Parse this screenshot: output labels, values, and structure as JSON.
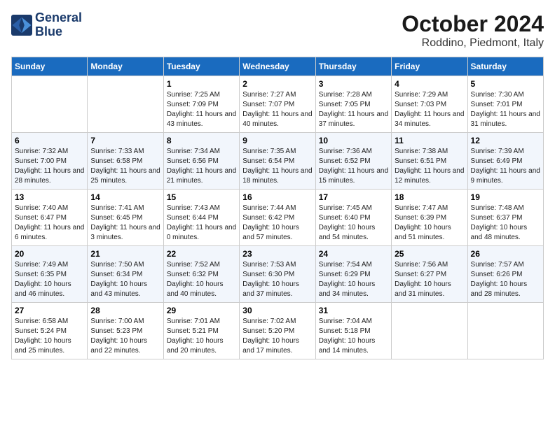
{
  "logo": {
    "line1": "General",
    "line2": "Blue"
  },
  "title": "October 2024",
  "subtitle": "Roddino, Piedmont, Italy",
  "weekdays": [
    "Sunday",
    "Monday",
    "Tuesday",
    "Wednesday",
    "Thursday",
    "Friday",
    "Saturday"
  ],
  "weeks": [
    [
      {
        "day": "",
        "sunrise": "",
        "sunset": "",
        "daylight": ""
      },
      {
        "day": "",
        "sunrise": "",
        "sunset": "",
        "daylight": ""
      },
      {
        "day": "1",
        "sunrise": "Sunrise: 7:25 AM",
        "sunset": "Sunset: 7:09 PM",
        "daylight": "Daylight: 11 hours and 43 minutes."
      },
      {
        "day": "2",
        "sunrise": "Sunrise: 7:27 AM",
        "sunset": "Sunset: 7:07 PM",
        "daylight": "Daylight: 11 hours and 40 minutes."
      },
      {
        "day": "3",
        "sunrise": "Sunrise: 7:28 AM",
        "sunset": "Sunset: 7:05 PM",
        "daylight": "Daylight: 11 hours and 37 minutes."
      },
      {
        "day": "4",
        "sunrise": "Sunrise: 7:29 AM",
        "sunset": "Sunset: 7:03 PM",
        "daylight": "Daylight: 11 hours and 34 minutes."
      },
      {
        "day": "5",
        "sunrise": "Sunrise: 7:30 AM",
        "sunset": "Sunset: 7:01 PM",
        "daylight": "Daylight: 11 hours and 31 minutes."
      }
    ],
    [
      {
        "day": "6",
        "sunrise": "Sunrise: 7:32 AM",
        "sunset": "Sunset: 7:00 PM",
        "daylight": "Daylight: 11 hours and 28 minutes."
      },
      {
        "day": "7",
        "sunrise": "Sunrise: 7:33 AM",
        "sunset": "Sunset: 6:58 PM",
        "daylight": "Daylight: 11 hours and 25 minutes."
      },
      {
        "day": "8",
        "sunrise": "Sunrise: 7:34 AM",
        "sunset": "Sunset: 6:56 PM",
        "daylight": "Daylight: 11 hours and 21 minutes."
      },
      {
        "day": "9",
        "sunrise": "Sunrise: 7:35 AM",
        "sunset": "Sunset: 6:54 PM",
        "daylight": "Daylight: 11 hours and 18 minutes."
      },
      {
        "day": "10",
        "sunrise": "Sunrise: 7:36 AM",
        "sunset": "Sunset: 6:52 PM",
        "daylight": "Daylight: 11 hours and 15 minutes."
      },
      {
        "day": "11",
        "sunrise": "Sunrise: 7:38 AM",
        "sunset": "Sunset: 6:51 PM",
        "daylight": "Daylight: 11 hours and 12 minutes."
      },
      {
        "day": "12",
        "sunrise": "Sunrise: 7:39 AM",
        "sunset": "Sunset: 6:49 PM",
        "daylight": "Daylight: 11 hours and 9 minutes."
      }
    ],
    [
      {
        "day": "13",
        "sunrise": "Sunrise: 7:40 AM",
        "sunset": "Sunset: 6:47 PM",
        "daylight": "Daylight: 11 hours and 6 minutes."
      },
      {
        "day": "14",
        "sunrise": "Sunrise: 7:41 AM",
        "sunset": "Sunset: 6:45 PM",
        "daylight": "Daylight: 11 hours and 3 minutes."
      },
      {
        "day": "15",
        "sunrise": "Sunrise: 7:43 AM",
        "sunset": "Sunset: 6:44 PM",
        "daylight": "Daylight: 11 hours and 0 minutes."
      },
      {
        "day": "16",
        "sunrise": "Sunrise: 7:44 AM",
        "sunset": "Sunset: 6:42 PM",
        "daylight": "Daylight: 10 hours and 57 minutes."
      },
      {
        "day": "17",
        "sunrise": "Sunrise: 7:45 AM",
        "sunset": "Sunset: 6:40 PM",
        "daylight": "Daylight: 10 hours and 54 minutes."
      },
      {
        "day": "18",
        "sunrise": "Sunrise: 7:47 AM",
        "sunset": "Sunset: 6:39 PM",
        "daylight": "Daylight: 10 hours and 51 minutes."
      },
      {
        "day": "19",
        "sunrise": "Sunrise: 7:48 AM",
        "sunset": "Sunset: 6:37 PM",
        "daylight": "Daylight: 10 hours and 48 minutes."
      }
    ],
    [
      {
        "day": "20",
        "sunrise": "Sunrise: 7:49 AM",
        "sunset": "Sunset: 6:35 PM",
        "daylight": "Daylight: 10 hours and 46 minutes."
      },
      {
        "day": "21",
        "sunrise": "Sunrise: 7:50 AM",
        "sunset": "Sunset: 6:34 PM",
        "daylight": "Daylight: 10 hours and 43 minutes."
      },
      {
        "day": "22",
        "sunrise": "Sunrise: 7:52 AM",
        "sunset": "Sunset: 6:32 PM",
        "daylight": "Daylight: 10 hours and 40 minutes."
      },
      {
        "day": "23",
        "sunrise": "Sunrise: 7:53 AM",
        "sunset": "Sunset: 6:30 PM",
        "daylight": "Daylight: 10 hours and 37 minutes."
      },
      {
        "day": "24",
        "sunrise": "Sunrise: 7:54 AM",
        "sunset": "Sunset: 6:29 PM",
        "daylight": "Daylight: 10 hours and 34 minutes."
      },
      {
        "day": "25",
        "sunrise": "Sunrise: 7:56 AM",
        "sunset": "Sunset: 6:27 PM",
        "daylight": "Daylight: 10 hours and 31 minutes."
      },
      {
        "day": "26",
        "sunrise": "Sunrise: 7:57 AM",
        "sunset": "Sunset: 6:26 PM",
        "daylight": "Daylight: 10 hours and 28 minutes."
      }
    ],
    [
      {
        "day": "27",
        "sunrise": "Sunrise: 6:58 AM",
        "sunset": "Sunset: 5:24 PM",
        "daylight": "Daylight: 10 hours and 25 minutes."
      },
      {
        "day": "28",
        "sunrise": "Sunrise: 7:00 AM",
        "sunset": "Sunset: 5:23 PM",
        "daylight": "Daylight: 10 hours and 22 minutes."
      },
      {
        "day": "29",
        "sunrise": "Sunrise: 7:01 AM",
        "sunset": "Sunset: 5:21 PM",
        "daylight": "Daylight: 10 hours and 20 minutes."
      },
      {
        "day": "30",
        "sunrise": "Sunrise: 7:02 AM",
        "sunset": "Sunset: 5:20 PM",
        "daylight": "Daylight: 10 hours and 17 minutes."
      },
      {
        "day": "31",
        "sunrise": "Sunrise: 7:04 AM",
        "sunset": "Sunset: 5:18 PM",
        "daylight": "Daylight: 10 hours and 14 minutes."
      },
      {
        "day": "",
        "sunrise": "",
        "sunset": "",
        "daylight": ""
      },
      {
        "day": "",
        "sunrise": "",
        "sunset": "",
        "daylight": ""
      }
    ]
  ]
}
